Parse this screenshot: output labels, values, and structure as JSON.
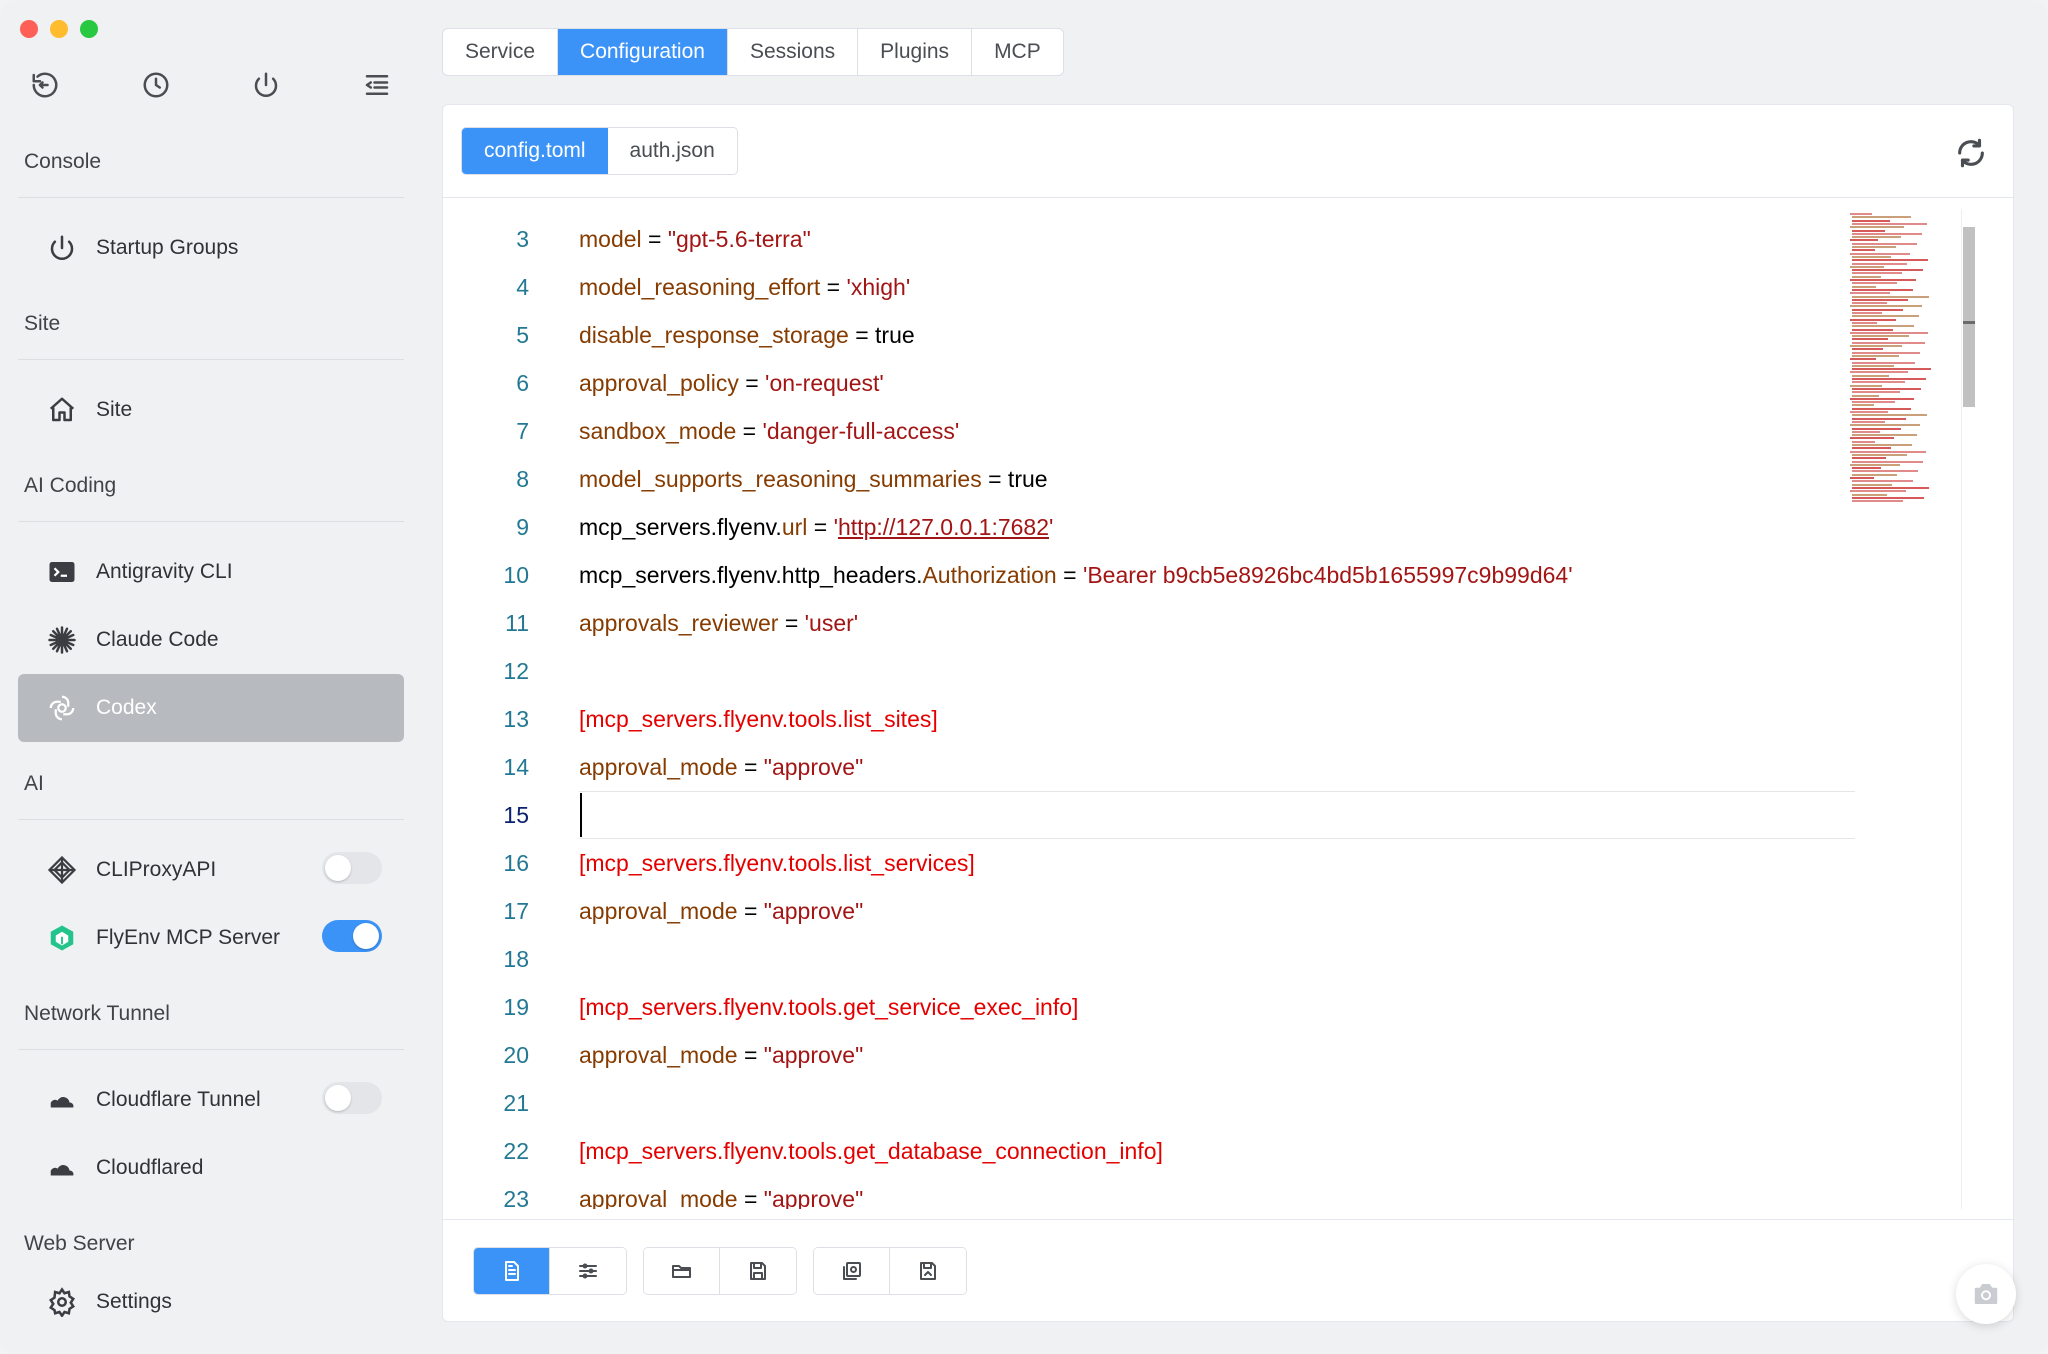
{
  "sidebar": {
    "sections": [
      {
        "title": "Console",
        "items": [
          {
            "label": "Startup Groups",
            "icon": "power-icon"
          }
        ]
      },
      {
        "title": "Site",
        "items": [
          {
            "label": "Site",
            "icon": "home-icon"
          }
        ]
      },
      {
        "title": "AI Coding",
        "items": [
          {
            "label": "Antigravity CLI",
            "icon": "terminal-icon"
          },
          {
            "label": "Claude Code",
            "icon": "claude-asterisk-icon"
          },
          {
            "label": "Codex",
            "icon": "openai-icon",
            "active": true
          }
        ]
      },
      {
        "title": "AI",
        "items": [
          {
            "label": "CLIProxyAPI",
            "icon": "diamond-icon",
            "toggle": false
          },
          {
            "label": "FlyEnv MCP Server",
            "icon": "cube-icon",
            "toggle": true
          }
        ]
      },
      {
        "title": "Network Tunnel",
        "items": [
          {
            "label": "Cloudflare Tunnel",
            "icon": "cloud-icon",
            "toggle": false
          },
          {
            "label": "Cloudflared",
            "icon": "cloud-icon"
          }
        ]
      },
      {
        "title": "Web Server",
        "items": [
          {
            "label": "Settings",
            "icon": "gear-icon"
          }
        ]
      }
    ]
  },
  "top_tabs": [
    "Service",
    "Configuration",
    "Sessions",
    "Plugins",
    "MCP"
  ],
  "top_tabs_active": "Configuration",
  "file_tabs": [
    "config.toml",
    "auth.json"
  ],
  "file_tabs_active": "config.toml",
  "editor": {
    "current_line": 15,
    "lines": [
      {
        "n": "3",
        "parts": [
          [
            "k",
            "model"
          ],
          [
            "p",
            " = "
          ],
          [
            "s",
            "\"gpt-5.6-terra\""
          ]
        ]
      },
      {
        "n": "4",
        "parts": [
          [
            "k",
            "model_reasoning_effort"
          ],
          [
            "p",
            " = "
          ],
          [
            "s",
            "'xhigh'"
          ]
        ]
      },
      {
        "n": "5",
        "parts": [
          [
            "k",
            "disable_response_storage"
          ],
          [
            "p",
            " = true"
          ]
        ]
      },
      {
        "n": "6",
        "parts": [
          [
            "k",
            "approval_policy"
          ],
          [
            "p",
            " = "
          ],
          [
            "s",
            "'on-request'"
          ]
        ]
      },
      {
        "n": "7",
        "parts": [
          [
            "k",
            "sandbox_mode"
          ],
          [
            "p",
            " = "
          ],
          [
            "s",
            "'danger-full-access'"
          ]
        ]
      },
      {
        "n": "8",
        "parts": [
          [
            "k",
            "model_supports_reasoning_summaries"
          ],
          [
            "p",
            " = true"
          ]
        ]
      },
      {
        "n": "9",
        "parts": [
          [
            "p",
            "mcp_servers.flyenv."
          ],
          [
            "k",
            "url"
          ],
          [
            "p",
            " = "
          ],
          [
            "s",
            "'"
          ],
          [
            "u",
            "http://127.0.0.1:7682"
          ],
          [
            "s",
            "'"
          ]
        ]
      },
      {
        "n": "10",
        "parts": [
          [
            "p",
            "mcp_servers.flyenv.http_headers."
          ],
          [
            "k",
            "Authorization"
          ],
          [
            "p",
            " = "
          ],
          [
            "s",
            "'Bearer b9cb5e8926bc4bd5b1655997c9b99d64'"
          ]
        ]
      },
      {
        "n": "11",
        "parts": [
          [
            "k",
            "approvals_reviewer"
          ],
          [
            "p",
            " = "
          ],
          [
            "s",
            "'user'"
          ]
        ]
      },
      {
        "n": "12",
        "parts": []
      },
      {
        "n": "13",
        "parts": [
          [
            "b",
            "[mcp_servers.flyenv.tools.list_sites]"
          ]
        ]
      },
      {
        "n": "14",
        "parts": [
          [
            "k",
            "approval_mode"
          ],
          [
            "p",
            " = "
          ],
          [
            "s",
            "\"approve\""
          ]
        ]
      },
      {
        "n": "15",
        "parts": []
      },
      {
        "n": "16",
        "parts": [
          [
            "b",
            "[mcp_servers.flyenv.tools.list_services]"
          ]
        ]
      },
      {
        "n": "17",
        "parts": [
          [
            "k",
            "approval_mode"
          ],
          [
            "p",
            " = "
          ],
          [
            "s",
            "\"approve\""
          ]
        ]
      },
      {
        "n": "18",
        "parts": []
      },
      {
        "n": "19",
        "parts": [
          [
            "b",
            "[mcp_servers.flyenv.tools.get_service_exec_info]"
          ]
        ]
      },
      {
        "n": "20",
        "parts": [
          [
            "k",
            "approval_mode"
          ],
          [
            "p",
            " = "
          ],
          [
            "s",
            "\"approve\""
          ]
        ]
      },
      {
        "n": "21",
        "parts": []
      },
      {
        "n": "22",
        "parts": [
          [
            "b",
            "[mcp_servers.flyenv.tools.get_database_connection_info]"
          ]
        ]
      },
      {
        "n": "23",
        "parts": [
          [
            "k",
            "approval_mode"
          ],
          [
            "p",
            " = "
          ],
          [
            "s",
            "\"approve\""
          ]
        ]
      }
    ]
  },
  "footer_tools": [
    [
      "file-text-icon",
      "sliders-icon"
    ],
    [
      "folder-open-icon",
      "save-icon"
    ],
    [
      "restore-icon",
      "save-as-icon"
    ]
  ],
  "colors": {
    "accent": "#3b93f7",
    "key": "#863b00",
    "string": "#a31515",
    "section": "#e50000",
    "line_number": "#237893"
  }
}
